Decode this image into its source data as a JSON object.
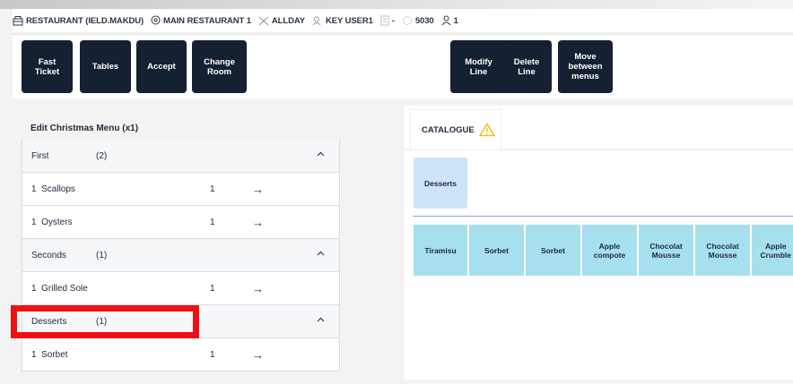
{
  "status": {
    "restaurant": "RESTAURANT (IELD.MAKDU)",
    "location": "MAIN RESTAURANT 1",
    "service": "ALLDAY",
    "user": "KEY USER1",
    "note": "-",
    "table": "5030",
    "guests": "1"
  },
  "toolbar": {
    "fast_ticket": "Fast\nTicket",
    "tables": "Tables",
    "accept": "Accept",
    "change_room": "Change\nRoom",
    "modify_line": "Modify\nLine",
    "delete_line": "Delete\nLine",
    "move_between_menus": "Move\nbetween\nmenus"
  },
  "menu": {
    "title": "Edit Christmas Menu (x1)",
    "arrow": "→",
    "groups": [
      {
        "name": "First",
        "count": "(2)",
        "items": [
          {
            "qty": "1",
            "name": "Scallops",
            "amount": "1"
          },
          {
            "qty": "1",
            "name": "Oysters",
            "amount": "1"
          }
        ]
      },
      {
        "name": "Seconds",
        "count": "(1)",
        "items": [
          {
            "qty": "1",
            "name": "Grilled Sole",
            "amount": "1"
          }
        ]
      },
      {
        "name": "Desserts",
        "count": "(1)",
        "items": [
          {
            "qty": "1",
            "name": "Sorbet",
            "amount": "1"
          }
        ]
      }
    ]
  },
  "catalogue": {
    "tab_label": "CATALOGUE",
    "category": "Desserts",
    "products": [
      "Tiramisu",
      "Sorbet",
      "Sorbet",
      "Apple\ncompote",
      "Chocolat\nMousse",
      "Chocolat\nMousse",
      "Apple\nCrumble"
    ]
  },
  "colors": {
    "button_bg": "#152033",
    "category_tile": "#cde4f6",
    "product_tile": "#a6e0ee",
    "highlight": "#ee1111",
    "warning": "#f5b400"
  }
}
